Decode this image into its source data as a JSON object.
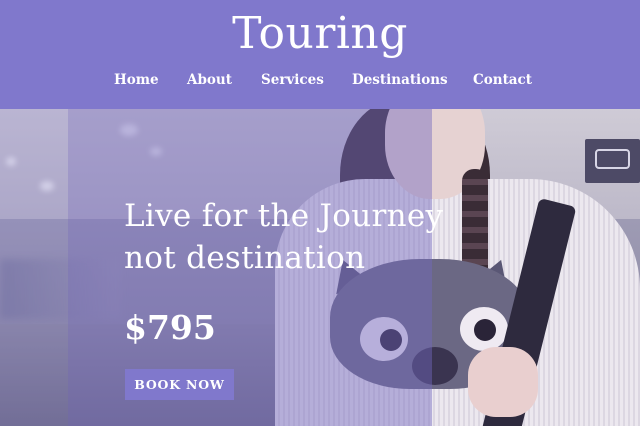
{
  "header": {
    "logo": "Touring",
    "nav": [
      "Home",
      "About",
      "Services",
      "Destinations",
      "Contact"
    ]
  },
  "hero": {
    "headline_line1": "Live for the Journey",
    "headline_line2": "not destination",
    "price": "$795",
    "cta_label": "BOOK NOW"
  },
  "colors": {
    "brand": "#8078cc",
    "text": "#ffffff"
  }
}
